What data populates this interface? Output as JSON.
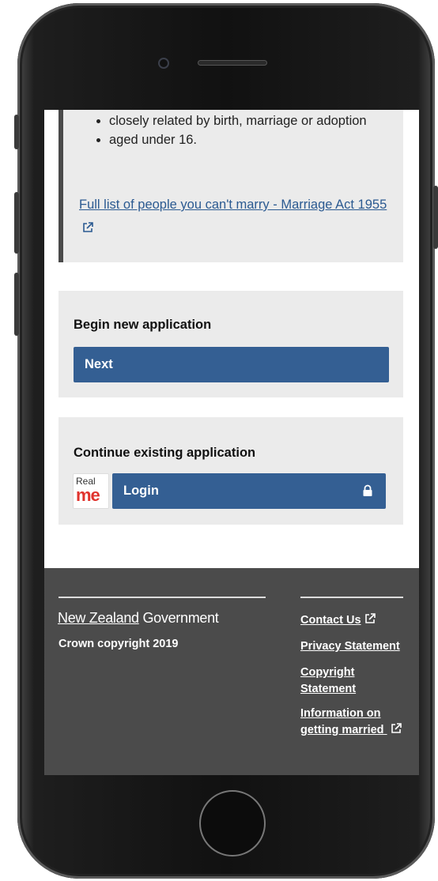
{
  "info": {
    "bullets": [
      "closely related by birth, marriage or adoption",
      "aged under 16."
    ],
    "link_text": "Full list of people you can't marry - Marriage Act 1955 "
  },
  "begin": {
    "title": "Begin new application",
    "button_label": "Next"
  },
  "continue": {
    "title": "Continue existing application",
    "realme_logo": {
      "line1": "Real",
      "line2": "me"
    },
    "button_label": "Login",
    "button_icon": "lock-icon"
  },
  "footer": {
    "govt_logo": {
      "part1": "New Zealand",
      "part2": " Government"
    },
    "copyright": "Crown copyright 2019",
    "links": [
      {
        "label": "Contact Us",
        "external": true
      },
      {
        "label": "Privacy Statement",
        "external": false
      },
      {
        "label": "Copyright Statement",
        "external": false
      },
      {
        "label": "Information on getting married",
        "external": true
      }
    ]
  },
  "colors": {
    "primary_button": "#345f93",
    "link": "#2b5a91",
    "footer_bg": "#4b4b4b",
    "panel_bg": "#ebebeb",
    "realme_red": "#e0332d"
  }
}
